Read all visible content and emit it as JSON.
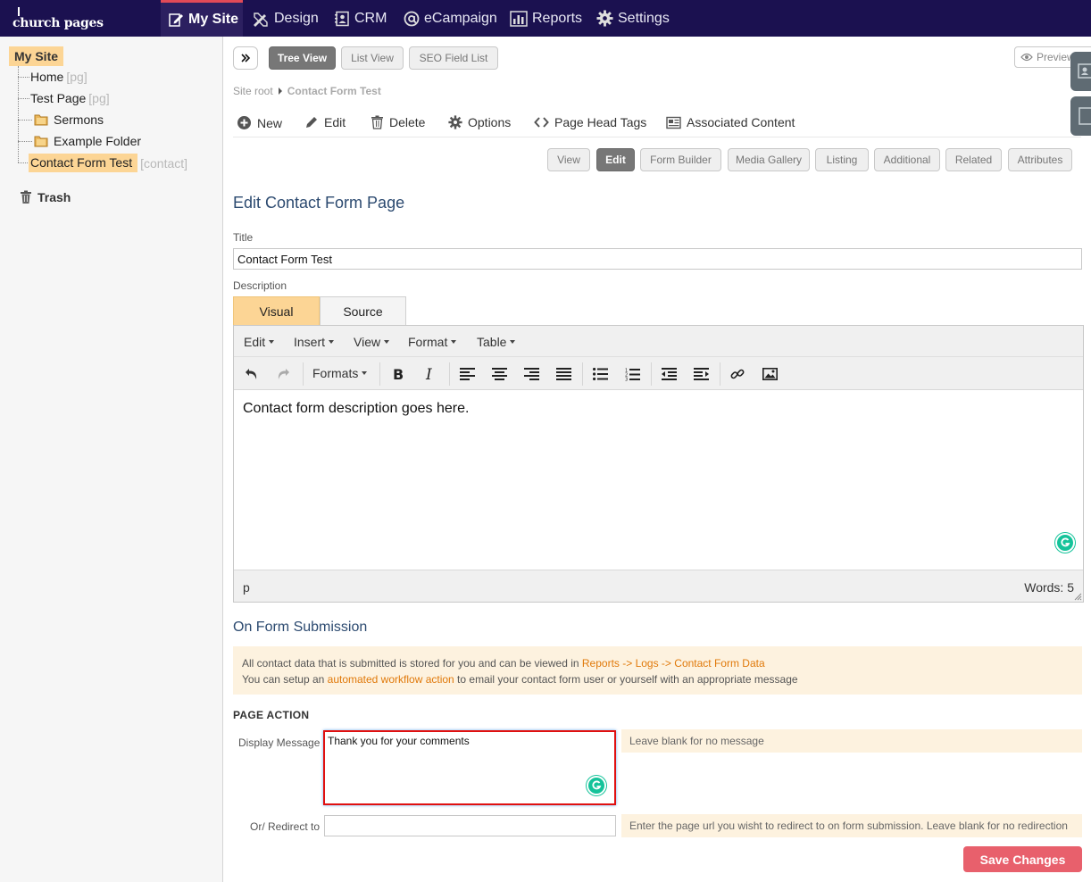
{
  "topnav": {
    "logo_text": "church pages",
    "items": [
      {
        "label": "My Site",
        "icon": "edit-page-icon",
        "active": true
      },
      {
        "label": "Design",
        "icon": "design-tools-icon"
      },
      {
        "label": "CRM",
        "icon": "address-book-icon"
      },
      {
        "label": "eCampaign",
        "icon": "at-sign-icon"
      },
      {
        "label": "Reports",
        "icon": "bar-chart-icon"
      },
      {
        "label": "Settings",
        "icon": "gear-icon"
      }
    ]
  },
  "sidebar": {
    "root": "My Site",
    "nodes": [
      {
        "label": "Home",
        "tag": "[pg]"
      },
      {
        "label": "Test Page",
        "tag": "[pg]"
      },
      {
        "label": "Sermons",
        "icon": "folder-icon"
      },
      {
        "label": "Example Folder",
        "icon": "folder-icon"
      },
      {
        "label": "Contact Form Test",
        "tag": "[contact]",
        "selected": true
      }
    ],
    "trash": "Trash"
  },
  "view_toggle": {
    "tree": "Tree View",
    "list": "List View",
    "seo": "SEO Field List",
    "preview": "Preview"
  },
  "breadcrumb": {
    "root": "Site root",
    "current": "Contact Form Test"
  },
  "actions": {
    "new": "New",
    "edit": "Edit",
    "delete": "Delete",
    "options": "Options",
    "page_head_tags": "Page Head Tags",
    "associated_content": "Associated Content"
  },
  "page_tabs": [
    "View",
    "Edit",
    "Form Builder",
    "Media Gallery",
    "Listing",
    "Additional",
    "Related",
    "Attributes"
  ],
  "form": {
    "heading": "Edit Contact Form Page",
    "title_label": "Title",
    "title_value": "Contact Form Test",
    "description_label": "Description"
  },
  "editor": {
    "tabs": {
      "visual": "Visual",
      "source": "Source"
    },
    "menus": [
      "Edit",
      "Insert",
      "View",
      "Format",
      "Table"
    ],
    "formats_label": "Formats",
    "content": "Contact form description goes here.",
    "status_path": "p",
    "word_count": "Words: 5"
  },
  "submission": {
    "heading": "On Form Submission",
    "info_line1_pre": "All contact data that is submitted is stored for you and can be viewed in ",
    "info_line1_link": "Reports -> Logs -> Contact Form Data",
    "info_line2_pre": "You can setup an ",
    "info_line2_link": "automated workflow action",
    "info_line2_post": " to email your contact form user or yourself with an appropriate message"
  },
  "page_action": {
    "heading": "PAGE ACTION",
    "display_message_label": "Display Message",
    "display_message_value": "Thank you for your comments",
    "display_message_hint": "Leave blank for no message",
    "redirect_label": "Or/ Redirect to",
    "redirect_value": "",
    "redirect_hint": "Enter the page url you wisht to redirect to on form submission. Leave blank for no redirection",
    "save_label": "Save Changes"
  },
  "colors": {
    "nav_bg": "#1b1150",
    "nav_active_border": "#e24a57",
    "highlight": "#fcd595",
    "link_orange": "#e0790a",
    "save_button": "#e8606c",
    "heading_blue": "#2c4a70"
  }
}
